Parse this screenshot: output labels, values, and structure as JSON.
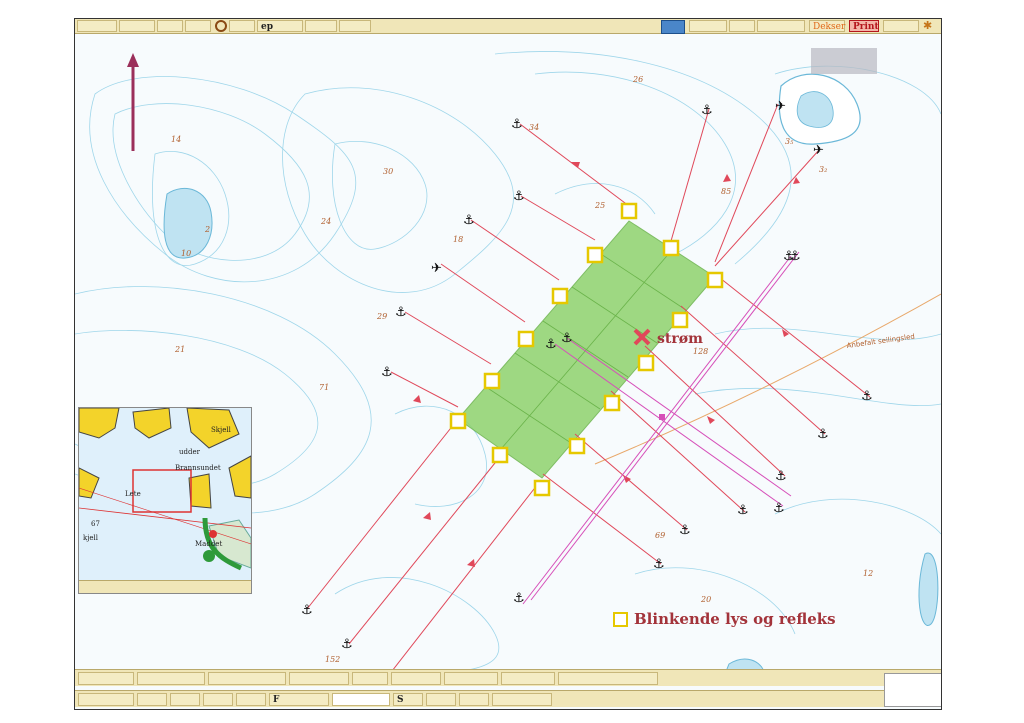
{
  "window": {
    "toolbar_left_text": "ep",
    "toolbar_right_buttons": [
      "Dekser",
      "Print"
    ]
  },
  "map": {
    "grid_fill_color": "#8fd36d",
    "line_color": "#e0485a",
    "magenta_line_color": "#d64fb9",
    "marker_border_color": "#e6c800",
    "marker_icon": "blinking-light-marker-icon",
    "anchor_icon": "anchor-icon",
    "current_label": "strøm",
    "current_icon": "x-cross-icon",
    "route_label": "Anbefalt seilingsled",
    "depths": [
      "14",
      "2",
      "10",
      "21",
      "30",
      "24",
      "18",
      "29",
      "71",
      "26",
      "34",
      "25",
      "85",
      "128",
      "69",
      "20",
      "12",
      "10",
      "152",
      "3₅",
      "3₂"
    ]
  },
  "inset": {
    "labels": [
      "Skjell",
      "udder",
      "Brannsundet",
      "Lete",
      "Maddet",
      "kjell",
      "67"
    ]
  },
  "legend": {
    "label": "Blinkende lys og refleks"
  },
  "bottom": {
    "field_f": "F",
    "field_s": "S"
  }
}
